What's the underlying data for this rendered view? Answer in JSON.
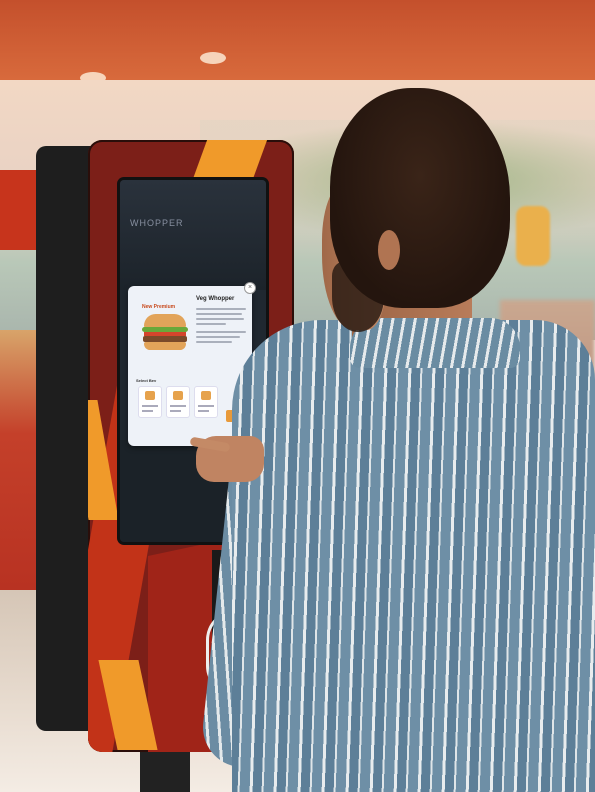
{
  "scene": {
    "description_kind": "photo",
    "kiosk": {
      "screen_header": "WHOPPER",
      "modal": {
        "badge": "New Premium",
        "title": "Veg Whopper",
        "section_label": "Select Bev",
        "close_icon": "close-icon"
      }
    },
    "colors": {
      "kiosk_brown": "#7c1f18",
      "kiosk_red": "#c23318",
      "kiosk_orange": "#f09a2a",
      "shirt_blue": "#6e8fa6"
    }
  }
}
